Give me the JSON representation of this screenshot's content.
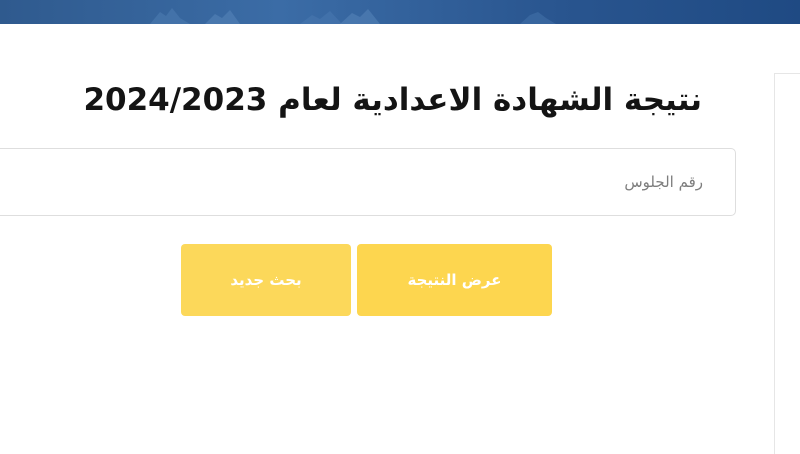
{
  "colors": {
    "banner": "#2f5a8e",
    "button": "#fdd64f",
    "button_text": "#ffffff",
    "title": "#141414",
    "input_border": "#dedede"
  },
  "header": {
    "title": "نتيجة الشهادة الاعدادية لعام 2024/2023"
  },
  "search": {
    "seat_number_placeholder": "رقم الجلوس",
    "seat_number_value": ""
  },
  "actions": {
    "show_result_label": "عرض النتيجة",
    "new_search_label": "بحث جديد"
  }
}
